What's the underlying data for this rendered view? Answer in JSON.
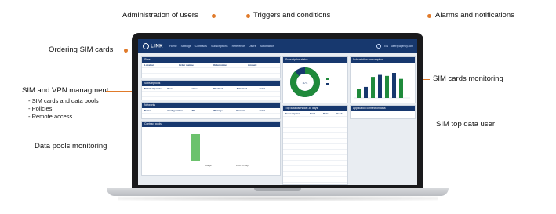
{
  "callouts": {
    "users": "Administration of users",
    "triggers": "Triggers and conditions",
    "alarms": "Alarms and notifications",
    "ordering": "Ordering SIM cards",
    "sim_vpn": "SIM and VPN managment",
    "sim_vpn_bullets": [
      "SIM cards and data pools",
      "Policies",
      "Remote access"
    ],
    "sim_cards_monitoring": "SIM cards monitoring",
    "sim_top": "SIM top data user",
    "data_pools": "Data pools monitoring"
  },
  "app": {
    "logo": "LINK",
    "nav": [
      "Home",
      "Settings",
      "Contracts",
      "Subscriptions",
      "Reference",
      "Users",
      "Automation"
    ],
    "user": "user@agency.com",
    "lang": "EN"
  },
  "panels": {
    "sims": {
      "title": "Sims",
      "cols": [
        "Location",
        "Order number",
        "Order status",
        "Amount"
      ]
    },
    "subscriptions": {
      "title": "Subscriptions",
      "cols": [
        "Mobile Operator",
        "Plan",
        "Active",
        "Blocked",
        "Activated",
        "Total"
      ]
    },
    "vpn": {
      "title": "Networks",
      "cols": [
        "Name",
        "Configuration",
        "APN",
        "IP range",
        "Remote",
        "Total"
      ]
    },
    "pools": {
      "title": "Contract pools",
      "legend": "Usage",
      "range": "Last 30 days"
    },
    "donut": {
      "title": "Subscription status",
      "center": "374"
    },
    "bars": {
      "title": "Subscription consumption"
    },
    "top": {
      "title": "Top data users last 30 days",
      "cols": [
        "Subscription",
        "Total",
        "Data",
        "Used"
      ]
    },
    "latest": {
      "title": "Application connection data"
    }
  },
  "chart_data": [
    {
      "type": "pie",
      "title": "",
      "values": [
        88,
        12
      ],
      "colors": [
        "#1f8a3b",
        "#17386e"
      ]
    },
    {
      "type": "bar",
      "title": "",
      "values": [
        18,
        22,
        42,
        46,
        44,
        50,
        38
      ],
      "colors": [
        "#1f8a3b",
        "#17386e"
      ]
    }
  ],
  "accent": "#e07a2a"
}
